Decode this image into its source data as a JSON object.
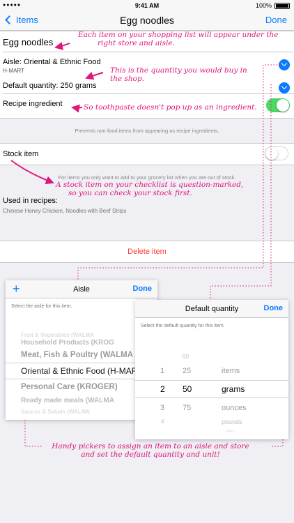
{
  "status_bar": {
    "carrier": "",
    "time": "9:41 AM",
    "battery": "100%"
  },
  "nav": {
    "back_label": "Items",
    "title": "Egg noodles",
    "done_label": "Done"
  },
  "item": {
    "name": "Egg noodles",
    "aisle": "Aisle: Oriental & Ethnic Food",
    "store": "H-MART",
    "default_quantity": "Default quantity: 250 grams",
    "recipe_ingredient_label": "Recipe ingredient",
    "recipe_ingredient_on": true,
    "recipe_note": "Prevents non-food items from appearing as recipe ingredients.",
    "stock_item_label": "Stock item",
    "stock_item_on": false,
    "stock_note": "For items you only want to add to your grocery list when you are out of stock.",
    "used_in_recipes_label": "Used in recipes:",
    "used_in_recipes": "Chinese Honey Chicken, Noodles with Beef Strips",
    "delete_label": "Delete item"
  },
  "annotations": {
    "name": [
      "Each item on your shopping list will appear under the",
      "right store and aisle."
    ],
    "quantity": [
      "This is the quantity you would buy in",
      "the shop."
    ],
    "recipe": "So toothpaste doesn't pop up as an ingredient.",
    "stock": [
      "A stock item on your checklist is question-marked,",
      "so you can check your stock first."
    ],
    "pickers": [
      "Handy pickers to assign an item to an aisle and store",
      "and set the default quantity and unit!"
    ]
  },
  "aisle_picker": {
    "title": "Aisle",
    "done_label": "Done",
    "add_icon": "plus-icon",
    "hint": "Select the aisle for this item.",
    "options": [
      "Fruit & Vegetables (WALMA",
      "Household Products (KROG",
      "Meat, Fish & Poultry (WALMA",
      "Oriental & Ethnic Food (H-MART",
      "Personal Care (KROGER)",
      "Ready made meals (WALMA",
      "Sauces & Salads (WALMA"
    ],
    "selected_index": 3
  },
  "quantity_picker": {
    "title": "Default quantity",
    "done_label": "Done",
    "hint": "Select the default quantity for this item.",
    "col1": [
      "",
      "",
      "1",
      "2",
      "3",
      "4",
      ""
    ],
    "col2": [
      "",
      "00",
      "25",
      "50",
      "75",
      "",
      ""
    ],
    "col3": [
      "",
      "",
      "items",
      "grams",
      "ounces",
      "pounds",
      "liters"
    ],
    "selected_index": 3
  },
  "colors": {
    "accent": "#0a7aff",
    "annotation": "#e0157a",
    "toggle_on": "#4cd964",
    "destructive": "#ff3b30"
  }
}
